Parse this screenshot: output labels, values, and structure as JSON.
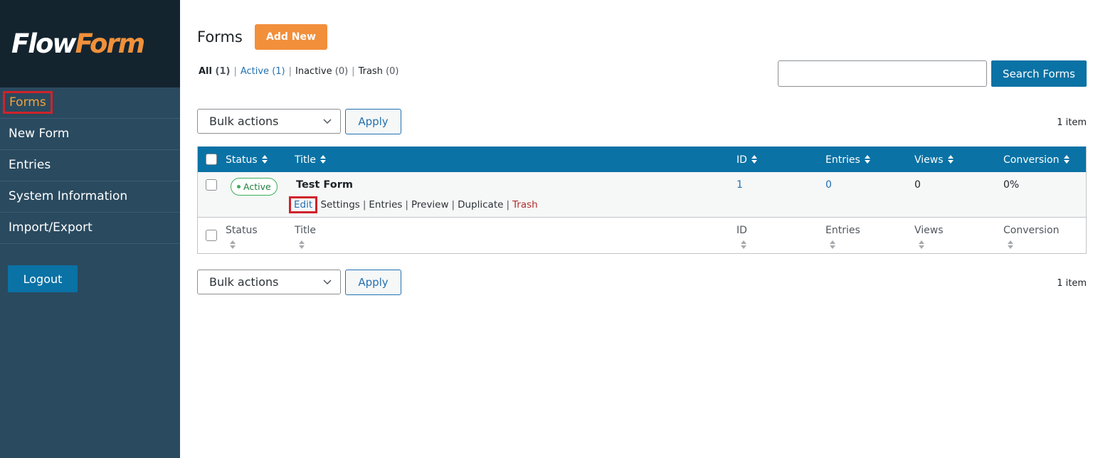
{
  "brand": {
    "logo_part1": "Flow",
    "logo_part2": "Form",
    "colors": {
      "sidebar": "#2a4a5f",
      "sidebar_top": "#14242f",
      "accent_orange": "#f28f3b",
      "primary_blue": "#0a72a5",
      "active_green": "#3cae5e",
      "trash_red": "#b32d2e"
    }
  },
  "sidebar": {
    "items": [
      {
        "label": "Forms",
        "active": true
      },
      {
        "label": "New Form"
      },
      {
        "label": "Entries"
      },
      {
        "label": "System Information"
      },
      {
        "label": "Import/Export"
      }
    ],
    "logout_label": "Logout"
  },
  "header": {
    "title": "Forms",
    "add_new_label": "Add New"
  },
  "filters": {
    "all": {
      "label": "All",
      "count": "(1)"
    },
    "active": {
      "label": "Active",
      "count": "(1)"
    },
    "inactive": {
      "label": "Inactive",
      "count": "(0)"
    },
    "trash": {
      "label": "Trash",
      "count": "(0)"
    },
    "separator": "|"
  },
  "search": {
    "value": "",
    "placeholder": "",
    "button_label": "Search Forms"
  },
  "bulk_top": {
    "selected": "Bulk actions",
    "apply_label": "Apply",
    "items_count": "1 item"
  },
  "bulk_bottom": {
    "selected": "Bulk actions",
    "apply_label": "Apply",
    "items_count": "1 item"
  },
  "table": {
    "columns": [
      "Status",
      "Title",
      "ID",
      "Entries",
      "Views",
      "Conversion"
    ],
    "rows": [
      {
        "status": "Active",
        "title": "Test Form",
        "id": "1",
        "entries": "0",
        "views": "0",
        "conversion": "0%",
        "actions": {
          "edit": "Edit",
          "settings": "Settings",
          "entries": "Entries",
          "preview": "Preview",
          "duplicate": "Duplicate",
          "trash": "Trash"
        }
      }
    ]
  }
}
